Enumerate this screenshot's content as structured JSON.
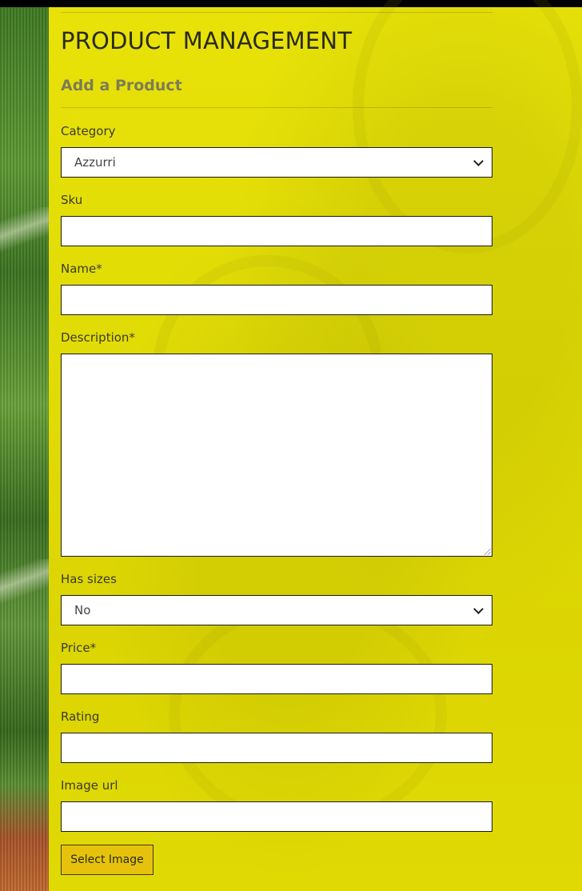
{
  "page": {
    "title": "PRODUCT MANAGEMENT",
    "subtitle": "Add a Product"
  },
  "form": {
    "category": {
      "label": "Category",
      "value": "Azzurri"
    },
    "sku": {
      "label": "Sku",
      "value": ""
    },
    "name": {
      "label": "Name*",
      "value": ""
    },
    "description": {
      "label": "Description*",
      "value": ""
    },
    "has_sizes": {
      "label": "Has sizes",
      "value": "No"
    },
    "price": {
      "label": "Price*",
      "value": ""
    },
    "rating": {
      "label": "Rating",
      "value": ""
    },
    "image_url": {
      "label": "Image url",
      "value": ""
    },
    "select_image_label": "Select Image"
  },
  "colors": {
    "panel": "#e2dc06",
    "button": "#e6c20c",
    "title": "#2a2a1a",
    "subtitle": "#7d7c56"
  },
  "icons": {
    "select_chevron": "chevron-down-icon",
    "textarea_grip": "resize-grip-icon"
  }
}
